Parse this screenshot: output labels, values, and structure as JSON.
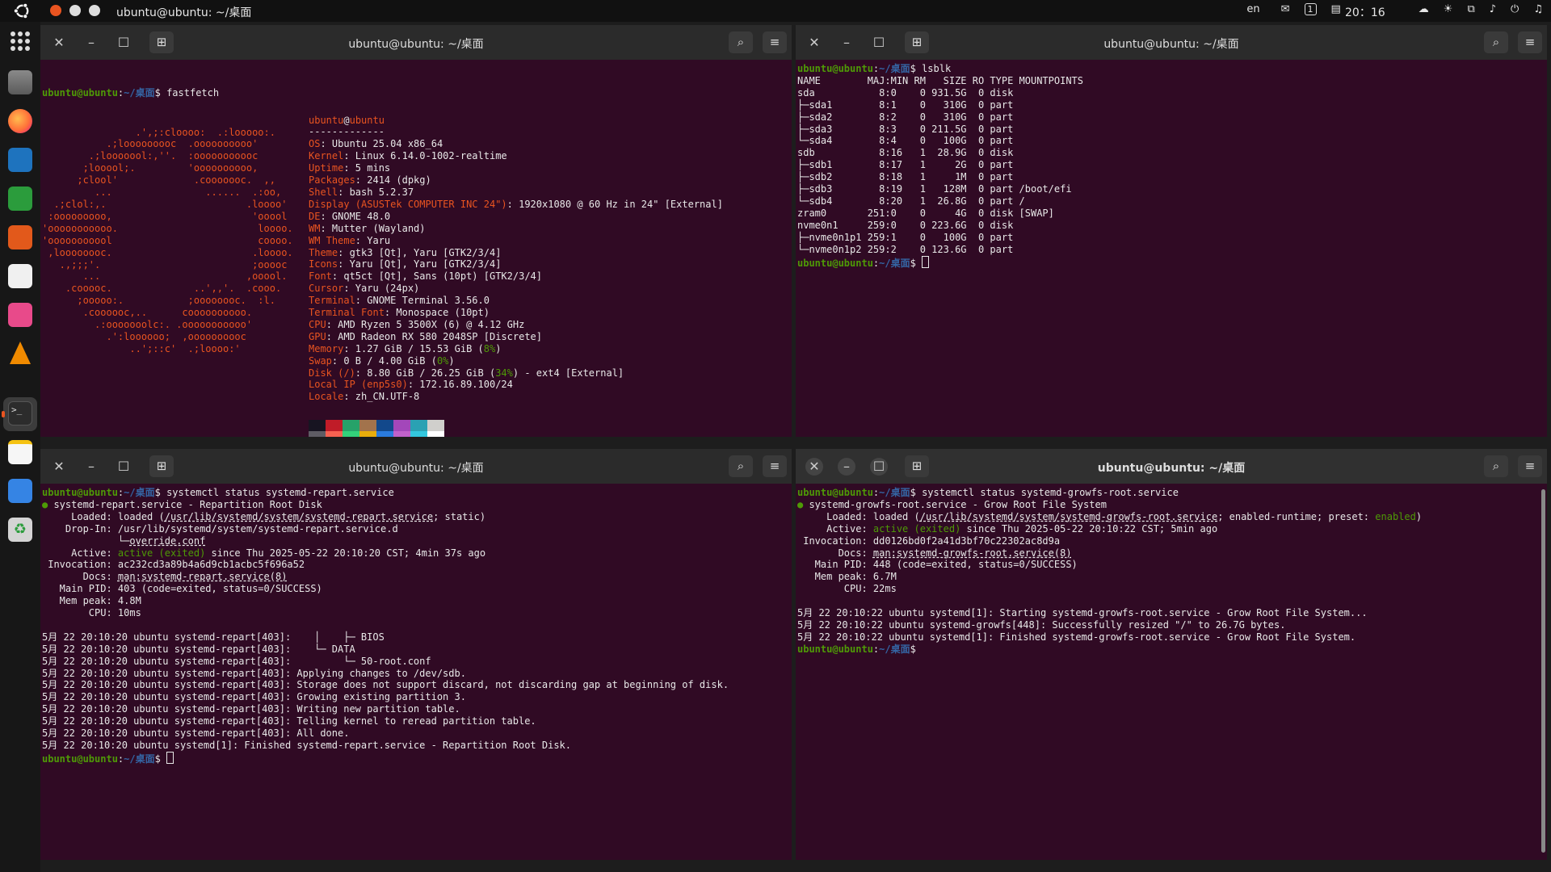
{
  "topbar": {
    "window_title": "ubuntu@ubuntu: ~/桌面",
    "input_method": "en",
    "clock": "20：16",
    "workspace_badge": "1"
  },
  "terminal_title": "ubuntu@ubuntu: ~/桌面",
  "prompt": {
    "user": "ubuntu@ubuntu",
    "path": "~/桌面",
    "sym": "$"
  },
  "terminals": [
    {
      "command": " fastfetch",
      "logo": [
        "                .',;:cloooo:  .:looooo:.",
        "           .;looooooooc  .oooooooooo'",
        "        .;looooool:,''.  :ooooooooooc",
        "       ;looool;.         'oooooooooo,",
        "      ;clool'             .cooooooc.  ,,",
        "         ...                ......  .:oo,",
        "  .;clol:,.                        .loooo'",
        " :ooooooooo,                        'ooool",
        "'ooooooooooo.                        loooo.",
        "'ooooooooool                         coooo.",
        " ,loooooooc.                        .loooo.",
        "   .,;;;'.                          ;ooooc",
        "       ...                         ,ooool.",
        "    .cooooc.              ..',,'.  .cooo.",
        "      ;ooooo:.           ;oooooooc.  :l.",
        "       .coooooc,..      coooooooooo.",
        "         .:ooooooolc:. .ooooooooooo'",
        "           .':loooooo;  ,oooooooooc",
        "               ..';::c'  .;loooo:'"
      ],
      "info_user": "ubuntu",
      "info_at": "@",
      "info_host": "ubuntu",
      "separator": "-------------",
      "info": [
        {
          "k": "OS",
          "v": ": Ubuntu 25.04 x86_64"
        },
        {
          "k": "Kernel",
          "v": ": Linux 6.14.0-1002-realtime"
        },
        {
          "k": "Uptime",
          "v": ": 5 mins"
        },
        {
          "k": "Packages",
          "v": ": 2414 (dpkg)"
        },
        {
          "k": "Shell",
          "v": ": bash 5.2.37"
        },
        {
          "k": "Display (ASUSTek COMPUTER INC 24\")",
          "v": ": 1920x1080 @ 60 Hz in 24\" [External]"
        },
        {
          "k": "DE",
          "v": ": GNOME 48.0"
        },
        {
          "k": "WM",
          "v": ": Mutter (Wayland)"
        },
        {
          "k": "WM Theme",
          "v": ": Yaru"
        },
        {
          "k": "Theme",
          "v": ": gtk3 [Qt], Yaru [GTK2/3/4]"
        },
        {
          "k": "Icons",
          "v": ": Yaru [Qt], Yaru [GTK2/3/4]"
        },
        {
          "k": "Font",
          "v": ": qt5ct [Qt], Sans (10pt) [GTK2/3/4]"
        },
        {
          "k": "Cursor",
          "v": ": Yaru (24px)"
        },
        {
          "k": "Terminal",
          "v": ": GNOME Terminal 3.56.0"
        },
        {
          "k": "Terminal Font",
          "v": ": Monospace (10pt)"
        },
        {
          "k": "CPU",
          "v": ": AMD Ryzen 5 3500X (6) @ 4.12 GHz"
        },
        {
          "k": "GPU",
          "v": ": AMD Radeon RX 580 2048SP [Discrete]"
        },
        {
          "k": "Memory",
          "v": ": 1.27 GiB / 15.53 GiB (",
          "pct": "8%",
          "tail": ")"
        },
        {
          "k": "Swap",
          "v": ": 0 B / 4.00 GiB (",
          "pct": "0%",
          "tail": ")"
        },
        {
          "k": "Disk (/)",
          "v": ": 8.80 GiB / 26.25 GiB (",
          "pct": "34%",
          "tail": ") - ext4 [External]"
        },
        {
          "k": "Local IP (enp5s0)",
          "v": ": 172.16.89.100/24"
        },
        {
          "k": "Locale",
          "v": ": zh_CN.UTF-8"
        }
      ],
      "palette": [
        "#171421",
        "#c01c28",
        "#26a269",
        "#a2734c",
        "#12488b",
        "#a347ba",
        "#2aa1b3",
        "#d0cfcc",
        "#5e5c64",
        "#f66151",
        "#33d17a",
        "#e9ad0c",
        "#2a7bde",
        "#c061cb",
        "#33c7de",
        "#ffffff"
      ]
    },
    {
      "command": " lsblk",
      "output": [
        "NAME        MAJ:MIN RM   SIZE RO TYPE MOUNTPOINTS",
        "sda           8:0    0 931.5G  0 disk",
        "├─sda1        8:1    0   310G  0 part",
        "├─sda2        8:2    0   310G  0 part",
        "├─sda3        8:3    0 211.5G  0 part",
        "└─sda4        8:4    0   100G  0 part",
        "sdb           8:16   1  28.9G  0 disk",
        "├─sdb1        8:17   1     2G  0 part",
        "├─sdb2        8:18   1     1M  0 part",
        "├─sdb3        8:19   1   128M  0 part /boot/efi",
        "└─sdb4        8:20   1  26.8G  0 part /",
        "zram0       251:0    0     4G  0 disk [SWAP]",
        "nvme0n1     259:0    0 223.6G  0 disk",
        "├─nvme0n1p1 259:1    0   100G  0 part",
        "└─nvme0n1p2 259:2    0 123.6G  0 part"
      ]
    },
    {
      "command": " systemctl status systemd-repart.service",
      "service_line": " systemd-repart.service - Repartition Root Disk",
      "loaded_pre": "     Loaded: loaded (",
      "loaded_path": "/usr/lib/systemd/system/systemd-repart.service",
      "loaded_post": "; static)",
      "dropin_pre": "    Drop-In: /usr/lib/systemd/system/systemd-repart.service.d",
      "dropin_tree": "             └─",
      "dropin_file": "override.conf",
      "active_pre": "     Active: ",
      "active_state": "active (exited)",
      "active_post": " since Thu 2025-05-22 20:10:20 CST; 4min 37s ago",
      "invocation": " Invocation: ac232cd3a89b4a6d9cb1acbc5f696a52",
      "docs_pre": "       Docs: ",
      "docs_link": "man:systemd-repart.service(8)",
      "mainpid": "   Main PID: 403 (code=exited, status=0/SUCCESS)",
      "mempeak": "   Mem peak: 4.8M",
      "cpu": "        CPU: 10ms",
      "log": [
        "5月 22 20:10:20 ubuntu systemd-repart[403]:    │    ├─ BIOS",
        "5月 22 20:10:20 ubuntu systemd-repart[403]:    └─ DATA",
        "5月 22 20:10:20 ubuntu systemd-repart[403]:         └─ 50-root.conf",
        "5月 22 20:10:20 ubuntu systemd-repart[403]: Applying changes to /dev/sdb.",
        "5月 22 20:10:20 ubuntu systemd-repart[403]: Storage does not support discard, not discarding gap at beginning of disk.",
        "5月 22 20:10:20 ubuntu systemd-repart[403]: Growing existing partition 3.",
        "5月 22 20:10:20 ubuntu systemd-repart[403]: Writing new partition table.",
        "5月 22 20:10:20 ubuntu systemd-repart[403]: Telling kernel to reread partition table.",
        "5月 22 20:10:20 ubuntu systemd-repart[403]: All done.",
        "5月 22 20:10:20 ubuntu systemd[1]: Finished systemd-repart.service - Repartition Root Disk."
      ]
    },
    {
      "command": " systemctl status systemd-growfs-root.service",
      "service_line": " systemd-growfs-root.service - Grow Root File System",
      "loaded_pre": "     Loaded: loaded (",
      "loaded_path": "/usr/lib/systemd/system/systemd-growfs-root.service",
      "loaded_post": "; enabled-runtime; preset: ",
      "loaded_preset": "enabled",
      "loaded_end": ")",
      "active_pre": "     Active: ",
      "active_state": "active (exited)",
      "active_post": " since Thu 2025-05-22 20:10:22 CST; 5min ago",
      "invocation": " Invocation: dd0126bd0f2a41d3bf70c22302ac8d9a",
      "docs_pre": "       Docs: ",
      "docs_link": "man:systemd-growfs-root.service(8)",
      "mainpid": "   Main PID: 448 (code=exited, status=0/SUCCESS)",
      "mempeak": "   Mem peak: 6.7M",
      "cpu": "        CPU: 22ms",
      "log": [
        "5月 22 20:10:22 ubuntu systemd[1]: Starting systemd-growfs-root.service - Grow Root File System...",
        "5月 22 20:10:22 ubuntu systemd-growfs[448]: Successfully resized \"/\" to 26.7G bytes.",
        "5月 22 20:10:22 ubuntu systemd[1]: Finished systemd-growfs-root.service - Grow Root File System."
      ]
    }
  ],
  "colors": {
    "terminal_bg": "#300a24",
    "prompt_user": "#4e9a06",
    "prompt_path": "#3465a4",
    "accent": "#e95420"
  }
}
